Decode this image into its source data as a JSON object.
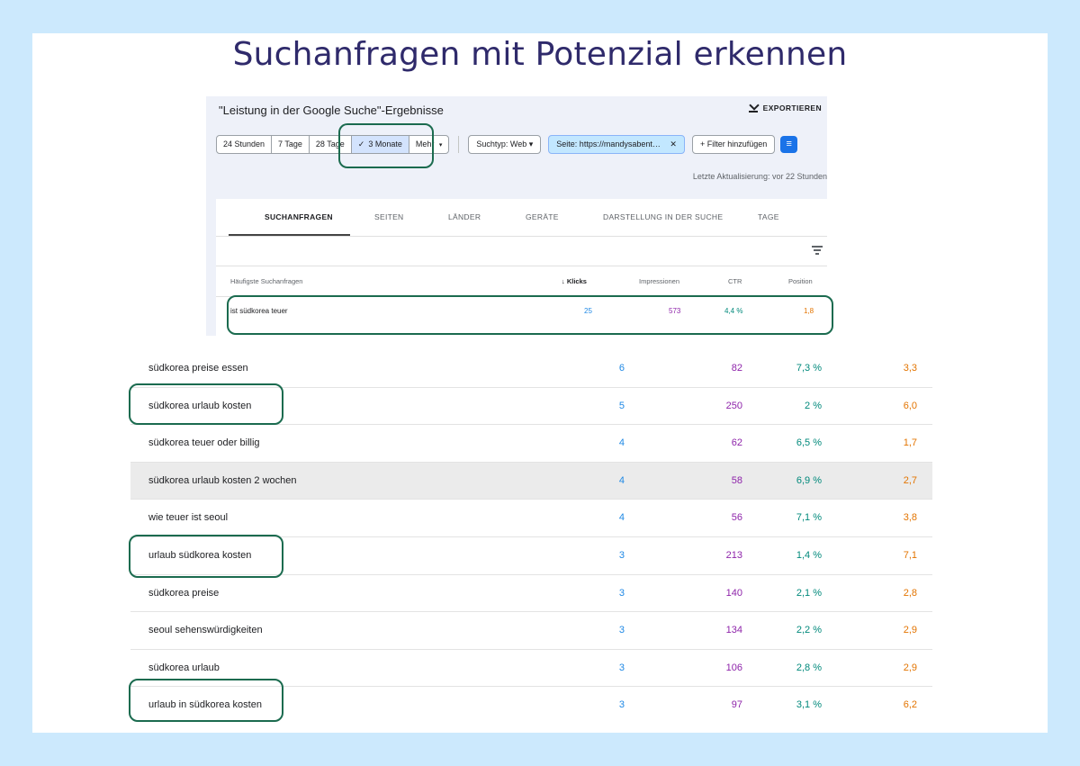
{
  "headline": "Suchanfragen mit Potenzial erkennen",
  "gsc": {
    "title": "\"Leistung in der Google Suche\"-Ergebnisse",
    "export_label": "EXPORTIEREN",
    "ranges": [
      "24 Stunden",
      "7 Tage",
      "28 Tage",
      "3 Monate",
      "Mehr"
    ],
    "selected_range_check": "✓",
    "more_caret": "▾",
    "search_type": "Suchtyp: Web ▾",
    "page_filter": "Seite: https://mandysabent…",
    "page_filter_close": "✕",
    "add_filter": "+ Filter hinzufügen",
    "filter_icon": "≡",
    "updated": "Letzte Aktualisierung: vor 22 Stunden",
    "tabs": [
      "SUCHANFRAGEN",
      "SEITEN",
      "LÄNDER",
      "GERÄTE",
      "DARSTELLUNG IN DER SUCHE",
      "TAGE"
    ],
    "columns": {
      "query": "Häufigste Suchanfragen",
      "clicks": "↓ Klicks",
      "impressions": "Impressionen",
      "ctr": "CTR",
      "position": "Position"
    },
    "first_row": {
      "query": "ist südkorea teuer",
      "clicks": "25",
      "impressions": "573",
      "ctr": "4,4 %",
      "position": "1,8"
    }
  },
  "rows": [
    {
      "query": "südkorea preise essen",
      "clicks": "6",
      "impressions": "82",
      "ctr": "7,3 %",
      "position": "3,3"
    },
    {
      "query": "südkorea urlaub kosten",
      "clicks": "5",
      "impressions": "250",
      "ctr": "2 %",
      "position": "6,0"
    },
    {
      "query": "südkorea teuer oder billig",
      "clicks": "4",
      "impressions": "62",
      "ctr": "6,5 %",
      "position": "1,7"
    },
    {
      "query": "südkorea urlaub kosten 2 wochen",
      "clicks": "4",
      "impressions": "58",
      "ctr": "6,9 %",
      "position": "2,7"
    },
    {
      "query": "wie teuer ist seoul",
      "clicks": "4",
      "impressions": "56",
      "ctr": "7,1 %",
      "position": "3,8"
    },
    {
      "query": "urlaub südkorea kosten",
      "clicks": "3",
      "impressions": "213",
      "ctr": "1,4 %",
      "position": "7,1"
    },
    {
      "query": "südkorea preise",
      "clicks": "3",
      "impressions": "140",
      "ctr": "2,1 %",
      "position": "2,8"
    },
    {
      "query": "seoul sehenswürdigkeiten",
      "clicks": "3",
      "impressions": "134",
      "ctr": "2,2 %",
      "position": "2,9"
    },
    {
      "query": "südkorea urlaub",
      "clicks": "3",
      "impressions": "106",
      "ctr": "2,8 %",
      "position": "2,9"
    },
    {
      "query": "urlaub in südkorea kosten",
      "clicks": "3",
      "impressions": "97",
      "ctr": "3,1 %",
      "position": "6,2"
    }
  ],
  "colors": {
    "background": "#cce9fd",
    "highlight_ring": "#1b6b4f",
    "clicks": "#1e88e5",
    "impressions": "#8e24aa",
    "ctr": "#00897b",
    "position": "#e37400"
  }
}
